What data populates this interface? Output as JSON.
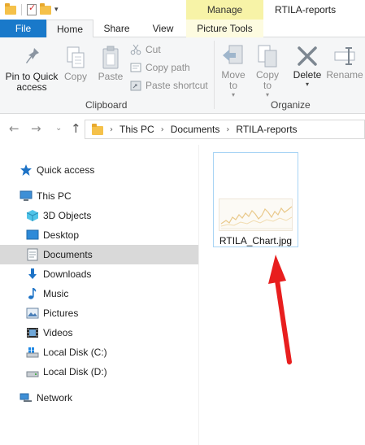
{
  "window": {
    "title": "RTILA-reports"
  },
  "ribbon_tabs": {
    "file": "File",
    "home": "Home",
    "share": "Share",
    "view": "View",
    "context_group": "Manage",
    "picture_tools": "Picture Tools"
  },
  "clipboard": {
    "pin": "Pin to Quick access",
    "copy": "Copy",
    "paste": "Paste",
    "cut": "Cut",
    "copy_path": "Copy path",
    "paste_shortcut": "Paste shortcut",
    "group_label": "Clipboard"
  },
  "organize": {
    "move_to": "Move to",
    "copy_to": "Copy to",
    "delete": "Delete",
    "rename": "Rename",
    "group_label": "Organize"
  },
  "address": {
    "crumbs": [
      "This PC",
      "Documents",
      "RTILA-reports"
    ]
  },
  "nav": {
    "quick_access": "Quick access",
    "this_pc": "This PC",
    "objects3d": "3D Objects",
    "desktop": "Desktop",
    "documents": "Documents",
    "downloads": "Downloads",
    "music": "Music",
    "pictures": "Pictures",
    "videos": "Videos",
    "disk_c": "Local Disk (C:)",
    "disk_d": "Local Disk (D:)",
    "network": "Network"
  },
  "files": [
    {
      "name": "RTILA_Chart.jpg"
    }
  ],
  "colors": {
    "file_tab": "#1979ca",
    "manage_tab": "#f7f3a7",
    "selected_nav": "#d9d9d9",
    "annotation_arrow": "#e81e1e"
  }
}
